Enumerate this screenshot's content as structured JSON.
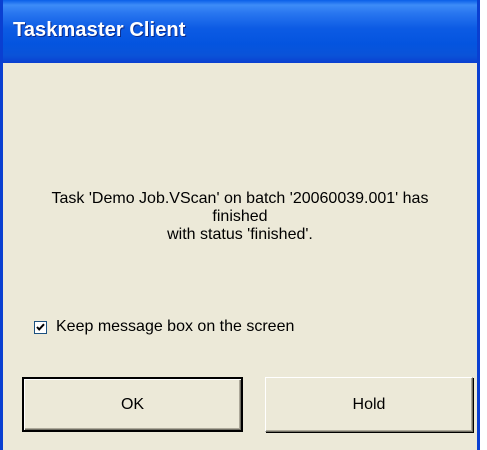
{
  "window": {
    "title": "Taskmaster Client"
  },
  "message": {
    "line1": "Task 'Demo Job.VScan' on batch '20060039.001' has",
    "line2": "finished",
    "line3": "with status 'finished'."
  },
  "keep_on_screen": {
    "label": "Keep message box on the screen",
    "checked": true
  },
  "buttons": {
    "ok_label": "OK",
    "hold_label": "Hold"
  },
  "colors": {
    "titlebar": "#0a5ee8",
    "dialog_bg": "#ece9d8",
    "border": "#0a3fd1"
  }
}
